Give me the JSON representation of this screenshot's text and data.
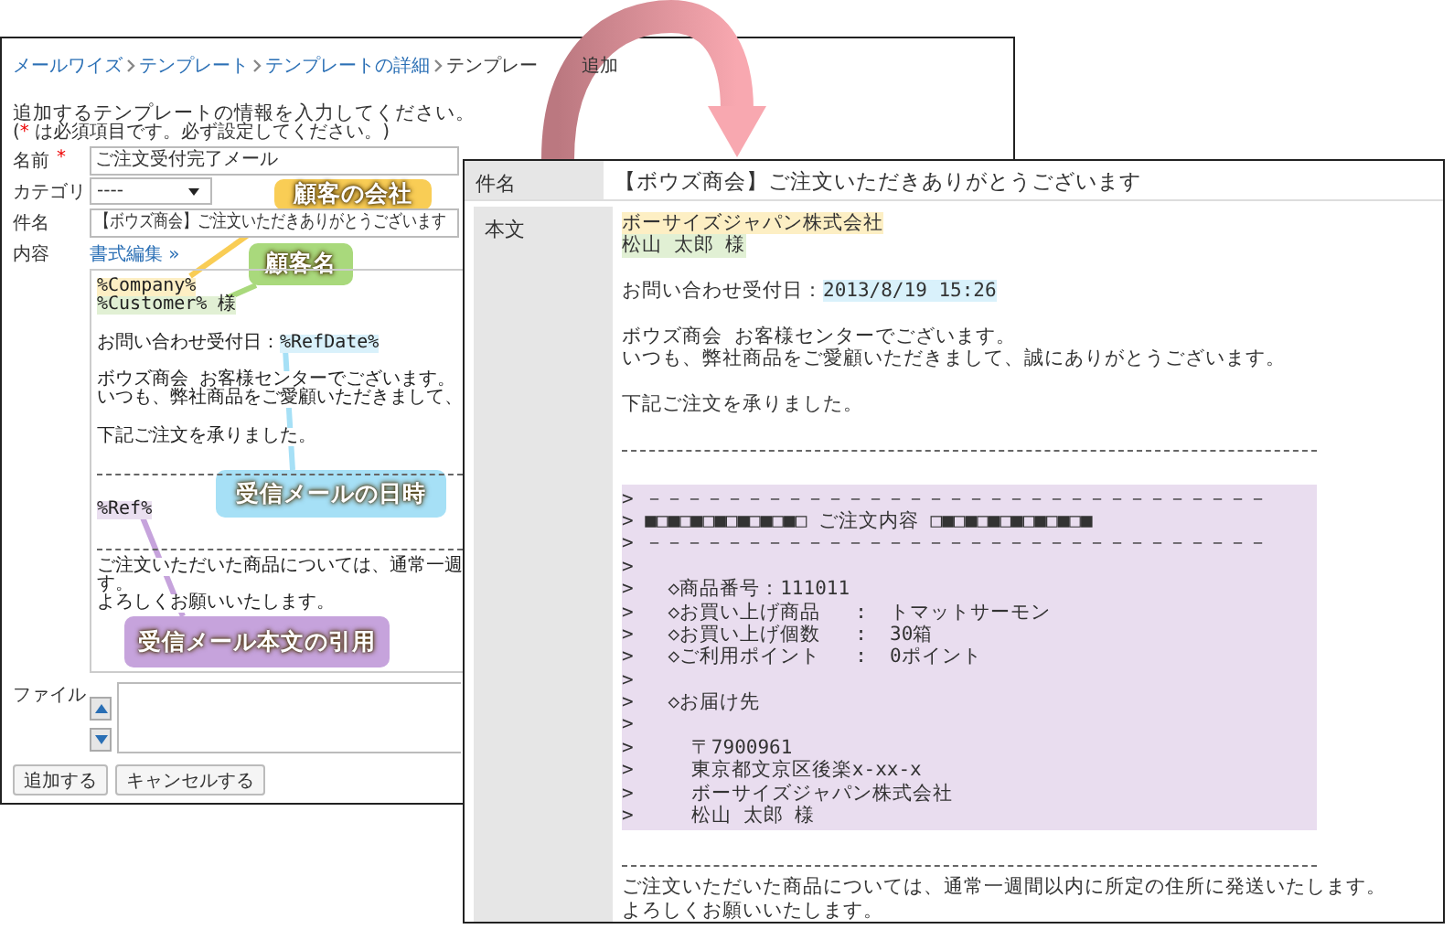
{
  "form_window": {
    "breadcrumb": {
      "links": [
        "メールワイズ",
        "テンプレート",
        "テンプレートの詳細"
      ],
      "current": [
        "テンプレー",
        "追加"
      ]
    },
    "instruction": "追加するテンプレートの情報を入力してください。",
    "note": {
      "before": "(",
      "mark": "*",
      "after": " は必須項目です。必ず設定してください。)"
    },
    "fields": [
      {
        "label": "名前",
        "required_mark": "*",
        "kind": "text",
        "value": "ご注文受付完了メール"
      },
      {
        "label": "カテゴリ",
        "kind": "select",
        "value": "----"
      },
      {
        "label": "件名",
        "kind": "text",
        "value": "【ボウズ商会】ご注文いただきありがとうございます"
      }
    ],
    "content": {
      "label": "内容",
      "link": "書式編集 »",
      "lines": [
        {
          "kind": "text",
          "segments": [
            {
              "text": "%Company%",
              "color": "#fdefc4"
            }
          ]
        },
        {
          "kind": "text",
          "segments": [
            {
              "text": "%Customer% 様",
              "color": "#e1f0d4"
            }
          ]
        },
        {
          "kind": "blank"
        },
        {
          "kind": "text",
          "segments": [
            {
              "text": "お問い合わせ受付日："
            },
            {
              "text": "%RefDate%",
              "color": "#d9f1fb"
            }
          ]
        },
        {
          "kind": "blank"
        },
        {
          "kind": "text",
          "segments": [
            {
              "text": "ボウズ商会 お客様センターでございます。"
            }
          ]
        },
        {
          "kind": "text",
          "segments": [
            {
              "text": "いつも、弊社商品をご愛顧いただきまして、"
            }
          ]
        },
        {
          "kind": "blank"
        },
        {
          "kind": "text",
          "segments": [
            {
              "text": "下記ご注文を承りました。"
            }
          ]
        },
        {
          "kind": "blank"
        },
        {
          "kind": "rule"
        },
        {
          "kind": "blank"
        },
        {
          "kind": "text",
          "segments": [
            {
              "text": "%Ref%",
              "color": "#eadff0"
            }
          ]
        },
        {
          "kind": "blank"
        },
        {
          "kind": "rule"
        },
        {
          "kind": "text",
          "segments": [
            {
              "text": "ご注文いただいた商品については、通常一週"
            }
          ]
        },
        {
          "kind": "text",
          "segments": [
            {
              "text": "す。"
            }
          ]
        },
        {
          "kind": "text",
          "segments": [
            {
              "text": "よろしくお願いいたします。"
            }
          ]
        }
      ]
    },
    "file": {
      "label": "ファイル"
    },
    "buttons": [
      "追加する",
      "キャンセルする"
    ]
  },
  "preview_window": {
    "rows": [
      {
        "label": "件名",
        "kind": "text",
        "value": "【ボウズ商会】ご注文いただきありがとうございます"
      },
      {
        "label": "本文",
        "kind": "body",
        "lines": [
          {
            "kind": "text",
            "segments": [
              {
                "text": "ボーサイズジャパン株式会社",
                "color": "#fdefc4"
              }
            ]
          },
          {
            "kind": "text",
            "segments": [
              {
                "text": "松山 太郎 様",
                "color": "#e1f0d4"
              }
            ]
          },
          {
            "kind": "blank"
          },
          {
            "kind": "text",
            "segments": [
              {
                "text": "お問い合わせ受付日："
              },
              {
                "text": "2013/8/19 15:26",
                "color": "#d9f1fb"
              }
            ]
          },
          {
            "kind": "blank"
          },
          {
            "kind": "text",
            "segments": [
              {
                "text": "ボウズ商会 お客様センターでございます。"
              }
            ]
          },
          {
            "kind": "text",
            "segments": [
              {
                "text": "いつも、弊社商品をご愛顧いただきまして、誠にありがとうございます。"
              }
            ]
          },
          {
            "kind": "blank"
          },
          {
            "kind": "text",
            "segments": [
              {
                "text": "下記ご注文を承りました。"
              }
            ]
          },
          {
            "kind": "blank"
          },
          {
            "kind": "rule"
          },
          {
            "kind": "blank"
          },
          {
            "kind": "quote",
            "lines": [
              "> －－－－－－－－－－－－－－－－－－－－－－－－－－－－－－－",
              "> ■□■□■□■□■□■□■□ ご注文内容 □■□■□■□■□■□■□■",
              "> －－－－－－－－－－－－－－－－－－－－－－－－－－－－－－－",
              ">",
              ">   ◇商品番号：111011",
              ">   ◇お買い上げ商品   :  トマットサーモン",
              ">   ◇お買い上げ個数   :  30箱",
              ">   ◇ご利用ポイント   :  0ポイント",
              ">",
              ">   ◇お届け先",
              ">",
              ">     〒7900961",
              ">     東京都文京区後楽x-xx-x",
              ">     ボーサイズジャパン株式会社",
              ">     松山 太郎 様"
            ]
          },
          {
            "kind": "blank"
          },
          {
            "kind": "rule"
          },
          {
            "kind": "text",
            "segments": [
              {
                "text": "ご注文いただいた商品については、通常一週間以内に所定の住所に発送いたします。"
              }
            ]
          },
          {
            "kind": "text",
            "segments": [
              {
                "text": "よろしくお願いいたします。"
              }
            ]
          }
        ]
      }
    ]
  },
  "callouts": [
    {
      "text": "顧客の会社",
      "color": "#f9cd55"
    },
    {
      "text": "顧客名",
      "color": "#a9d97c"
    },
    {
      "text": "受信メールの日時",
      "color": "#a6e0f6"
    },
    {
      "text": "受信メール本文の引用",
      "color": "#c6a3dc"
    }
  ]
}
